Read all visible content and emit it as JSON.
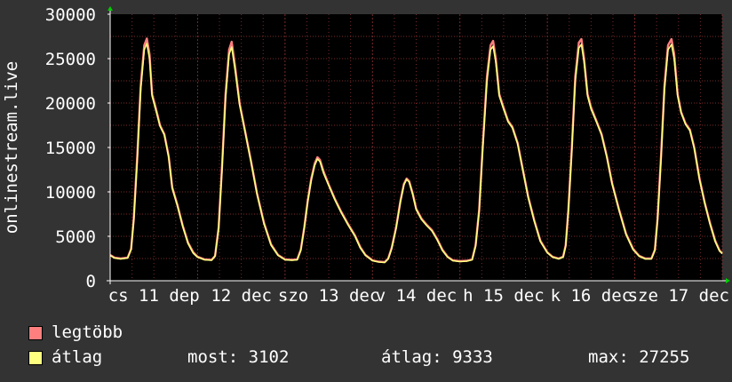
{
  "colors": {
    "background": "#333333",
    "plot_background": "#000000",
    "grid": "#7a2a2a",
    "axis": "#ffffff",
    "arrow": "#00cc00",
    "max_series": "#ff7f7f",
    "avg_series": "#ffff7f",
    "text": "#ffffff"
  },
  "legend": {
    "max_label": "legtöbb",
    "avg_label": "átlag",
    "now_text": "most: 3102",
    "avg_text": "átlag: 9333",
    "max_text": "max: 27255"
  },
  "chart_data": {
    "type": "line",
    "ylabel": "onlinestream.live",
    "ylim": [
      0,
      30000
    ],
    "yticks": [
      0,
      5000,
      10000,
      15000,
      20000,
      25000,
      30000
    ],
    "xlim": [
      0,
      7
    ],
    "xticks": [
      {
        "x": 0.0,
        "label": "cs 11 dep"
      },
      {
        "x": 1.0,
        "label": "12 dec"
      },
      {
        "x": 2.0,
        "label": "szo 13 dec"
      },
      {
        "x": 3.0,
        "label": "v 14 dec"
      },
      {
        "x": 4.0,
        "label": "h 15 dec"
      },
      {
        "x": 5.0,
        "label": "k 16 dec"
      },
      {
        "x": 6.0,
        "label": "sze 17 dec"
      }
    ],
    "grid": true,
    "legend_position": "bottom-left",
    "series": [
      {
        "name": "legtöbb",
        "color": "#ff7f7f",
        "points": [
          [
            0.0,
            2900
          ],
          [
            0.05,
            2600
          ],
          [
            0.12,
            2500
          ],
          [
            0.2,
            2600
          ],
          [
            0.24,
            3600
          ],
          [
            0.27,
            7000
          ],
          [
            0.31,
            14000
          ],
          [
            0.35,
            22000
          ],
          [
            0.39,
            26500
          ],
          [
            0.42,
            27255
          ],
          [
            0.45,
            25500
          ],
          [
            0.48,
            21000
          ],
          [
            0.52,
            19500
          ],
          [
            0.57,
            17500
          ],
          [
            0.62,
            16500
          ],
          [
            0.67,
            14000
          ],
          [
            0.71,
            10500
          ],
          [
            0.77,
            8500
          ],
          [
            0.83,
            6200
          ],
          [
            0.89,
            4300
          ],
          [
            0.95,
            3200
          ],
          [
            1.0,
            2700
          ],
          [
            1.08,
            2400
          ],
          [
            1.16,
            2350
          ],
          [
            1.2,
            2800
          ],
          [
            1.24,
            6000
          ],
          [
            1.28,
            13000
          ],
          [
            1.32,
            21000
          ],
          [
            1.36,
            26000
          ],
          [
            1.39,
            26900
          ],
          [
            1.43,
            24000
          ],
          [
            1.48,
            20000
          ],
          [
            1.54,
            17000
          ],
          [
            1.61,
            13500
          ],
          [
            1.68,
            9800
          ],
          [
            1.76,
            6500
          ],
          [
            1.84,
            4100
          ],
          [
            1.92,
            2900
          ],
          [
            2.0,
            2400
          ],
          [
            2.08,
            2350
          ],
          [
            2.14,
            2400
          ],
          [
            2.18,
            3500
          ],
          [
            2.22,
            6000
          ],
          [
            2.26,
            9000
          ],
          [
            2.3,
            11500
          ],
          [
            2.34,
            13200
          ],
          [
            2.37,
            13900
          ],
          [
            2.4,
            13600
          ],
          [
            2.44,
            12300
          ],
          [
            2.5,
            10800
          ],
          [
            2.57,
            9200
          ],
          [
            2.64,
            7800
          ],
          [
            2.72,
            6400
          ],
          [
            2.8,
            5100
          ],
          [
            2.86,
            3800
          ],
          [
            2.92,
            2900
          ],
          [
            3.0,
            2300
          ],
          [
            3.07,
            2150
          ],
          [
            3.14,
            2100
          ],
          [
            3.18,
            2500
          ],
          [
            3.22,
            3700
          ],
          [
            3.27,
            6000
          ],
          [
            3.32,
            9000
          ],
          [
            3.36,
            10900
          ],
          [
            3.39,
            11500
          ],
          [
            3.42,
            11200
          ],
          [
            3.46,
            9800
          ],
          [
            3.5,
            8100
          ],
          [
            3.56,
            7000
          ],
          [
            3.62,
            6300
          ],
          [
            3.68,
            5700
          ],
          [
            3.74,
            4700
          ],
          [
            3.8,
            3500
          ],
          [
            3.86,
            2700
          ],
          [
            3.92,
            2300
          ],
          [
            4.0,
            2200
          ],
          [
            4.08,
            2250
          ],
          [
            4.14,
            2400
          ],
          [
            4.18,
            4000
          ],
          [
            4.22,
            8000
          ],
          [
            4.26,
            15000
          ],
          [
            4.31,
            23000
          ],
          [
            4.35,
            26500
          ],
          [
            4.38,
            27000
          ],
          [
            4.41,
            25000
          ],
          [
            4.45,
            21000
          ],
          [
            4.5,
            19500
          ],
          [
            4.55,
            18000
          ],
          [
            4.6,
            17300
          ],
          [
            4.66,
            15500
          ],
          [
            4.72,
            12500
          ],
          [
            4.78,
            9500
          ],
          [
            4.85,
            6800
          ],
          [
            4.92,
            4500
          ],
          [
            5.0,
            3200
          ],
          [
            5.06,
            2700
          ],
          [
            5.13,
            2500
          ],
          [
            5.18,
            2700
          ],
          [
            5.21,
            4000
          ],
          [
            5.24,
            8000
          ],
          [
            5.28,
            15000
          ],
          [
            5.32,
            23000
          ],
          [
            5.36,
            26800
          ],
          [
            5.39,
            27200
          ],
          [
            5.42,
            25000
          ],
          [
            5.46,
            21000
          ],
          [
            5.5,
            19500
          ],
          [
            5.56,
            18000
          ],
          [
            5.62,
            16500
          ],
          [
            5.68,
            14000
          ],
          [
            5.74,
            11000
          ],
          [
            5.82,
            8000
          ],
          [
            5.9,
            5300
          ],
          [
            5.98,
            3600
          ],
          [
            6.05,
            2800
          ],
          [
            6.12,
            2500
          ],
          [
            6.19,
            2500
          ],
          [
            6.23,
            3500
          ],
          [
            6.26,
            7000
          ],
          [
            6.3,
            14000
          ],
          [
            6.34,
            22000
          ],
          [
            6.38,
            26500
          ],
          [
            6.42,
            27200
          ],
          [
            6.45,
            25500
          ],
          [
            6.49,
            21000
          ],
          [
            6.53,
            19000
          ],
          [
            6.58,
            17700
          ],
          [
            6.63,
            17000
          ],
          [
            6.68,
            15000
          ],
          [
            6.74,
            11500
          ],
          [
            6.8,
            8800
          ],
          [
            6.86,
            6500
          ],
          [
            6.92,
            4500
          ],
          [
            6.97,
            3400
          ],
          [
            7.0,
            3102
          ]
        ]
      },
      {
        "name": "átlag",
        "color": "#ffff7f",
        "points": [
          [
            0.0,
            2850
          ],
          [
            0.05,
            2550
          ],
          [
            0.12,
            2450
          ],
          [
            0.2,
            2550
          ],
          [
            0.24,
            3500
          ],
          [
            0.27,
            6800
          ],
          [
            0.31,
            13500
          ],
          [
            0.35,
            21500
          ],
          [
            0.39,
            26000
          ],
          [
            0.42,
            26700
          ],
          [
            0.45,
            25000
          ],
          [
            0.48,
            20800
          ],
          [
            0.52,
            19300
          ],
          [
            0.57,
            17400
          ],
          [
            0.62,
            16400
          ],
          [
            0.67,
            13900
          ],
          [
            0.71,
            10400
          ],
          [
            0.77,
            8400
          ],
          [
            0.83,
            6100
          ],
          [
            0.89,
            4200
          ],
          [
            0.95,
            3100
          ],
          [
            1.0,
            2650
          ],
          [
            1.08,
            2350
          ],
          [
            1.16,
            2300
          ],
          [
            1.2,
            2750
          ],
          [
            1.24,
            5800
          ],
          [
            1.28,
            12600
          ],
          [
            1.32,
            20500
          ],
          [
            1.36,
            25500
          ],
          [
            1.39,
            26300
          ],
          [
            1.43,
            23600
          ],
          [
            1.48,
            19800
          ],
          [
            1.54,
            16900
          ],
          [
            1.61,
            13400
          ],
          [
            1.68,
            9700
          ],
          [
            1.76,
            6400
          ],
          [
            1.84,
            4000
          ],
          [
            1.92,
            2850
          ],
          [
            2.0,
            2350
          ],
          [
            2.08,
            2300
          ],
          [
            2.14,
            2350
          ],
          [
            2.18,
            3400
          ],
          [
            2.22,
            5900
          ],
          [
            2.26,
            8900
          ],
          [
            2.3,
            11300
          ],
          [
            2.34,
            13000
          ],
          [
            2.37,
            13700
          ],
          [
            2.4,
            13400
          ],
          [
            2.44,
            12100
          ],
          [
            2.5,
            10700
          ],
          [
            2.57,
            9100
          ],
          [
            2.64,
            7700
          ],
          [
            2.72,
            6300
          ],
          [
            2.8,
            5000
          ],
          [
            2.86,
            3700
          ],
          [
            2.92,
            2850
          ],
          [
            3.0,
            2250
          ],
          [
            3.07,
            2100
          ],
          [
            3.14,
            2050
          ],
          [
            3.18,
            2450
          ],
          [
            3.22,
            3600
          ],
          [
            3.27,
            5900
          ],
          [
            3.32,
            8900
          ],
          [
            3.36,
            10800
          ],
          [
            3.39,
            11400
          ],
          [
            3.42,
            11100
          ],
          [
            3.46,
            9700
          ],
          [
            3.5,
            8000
          ],
          [
            3.56,
            6900
          ],
          [
            3.62,
            6200
          ],
          [
            3.68,
            5600
          ],
          [
            3.74,
            4600
          ],
          [
            3.8,
            3400
          ],
          [
            3.86,
            2650
          ],
          [
            3.92,
            2250
          ],
          [
            4.0,
            2150
          ],
          [
            4.08,
            2200
          ],
          [
            4.14,
            2350
          ],
          [
            4.18,
            3900
          ],
          [
            4.22,
            7800
          ],
          [
            4.26,
            14600
          ],
          [
            4.31,
            22500
          ],
          [
            4.35,
            26000
          ],
          [
            4.38,
            26400
          ],
          [
            4.41,
            24600
          ],
          [
            4.45,
            20800
          ],
          [
            4.5,
            19300
          ],
          [
            4.55,
            17900
          ],
          [
            4.6,
            17200
          ],
          [
            4.66,
            15400
          ],
          [
            4.72,
            12400
          ],
          [
            4.78,
            9400
          ],
          [
            4.85,
            6700
          ],
          [
            4.92,
            4400
          ],
          [
            5.0,
            3150
          ],
          [
            5.06,
            2650
          ],
          [
            5.13,
            2450
          ],
          [
            5.18,
            2650
          ],
          [
            5.21,
            3900
          ],
          [
            5.24,
            7800
          ],
          [
            5.28,
            14600
          ],
          [
            5.32,
            22500
          ],
          [
            5.36,
            26200
          ],
          [
            5.39,
            26600
          ],
          [
            5.42,
            24600
          ],
          [
            5.46,
            20800
          ],
          [
            5.5,
            19300
          ],
          [
            5.56,
            17900
          ],
          [
            5.62,
            16400
          ],
          [
            5.68,
            13900
          ],
          [
            5.74,
            10900
          ],
          [
            5.82,
            7900
          ],
          [
            5.9,
            5200
          ],
          [
            5.98,
            3500
          ],
          [
            6.05,
            2750
          ],
          [
            6.12,
            2450
          ],
          [
            6.19,
            2450
          ],
          [
            6.23,
            3400
          ],
          [
            6.26,
            6800
          ],
          [
            6.3,
            13600
          ],
          [
            6.34,
            21500
          ],
          [
            6.38,
            26000
          ],
          [
            6.42,
            26600
          ],
          [
            6.45,
            25000
          ],
          [
            6.49,
            20800
          ],
          [
            6.53,
            18900
          ],
          [
            6.58,
            17600
          ],
          [
            6.63,
            16900
          ],
          [
            6.68,
            14900
          ],
          [
            6.74,
            11400
          ],
          [
            6.8,
            8700
          ],
          [
            6.86,
            6400
          ],
          [
            6.92,
            4400
          ],
          [
            6.97,
            3350
          ],
          [
            7.0,
            3050
          ]
        ]
      }
    ]
  }
}
